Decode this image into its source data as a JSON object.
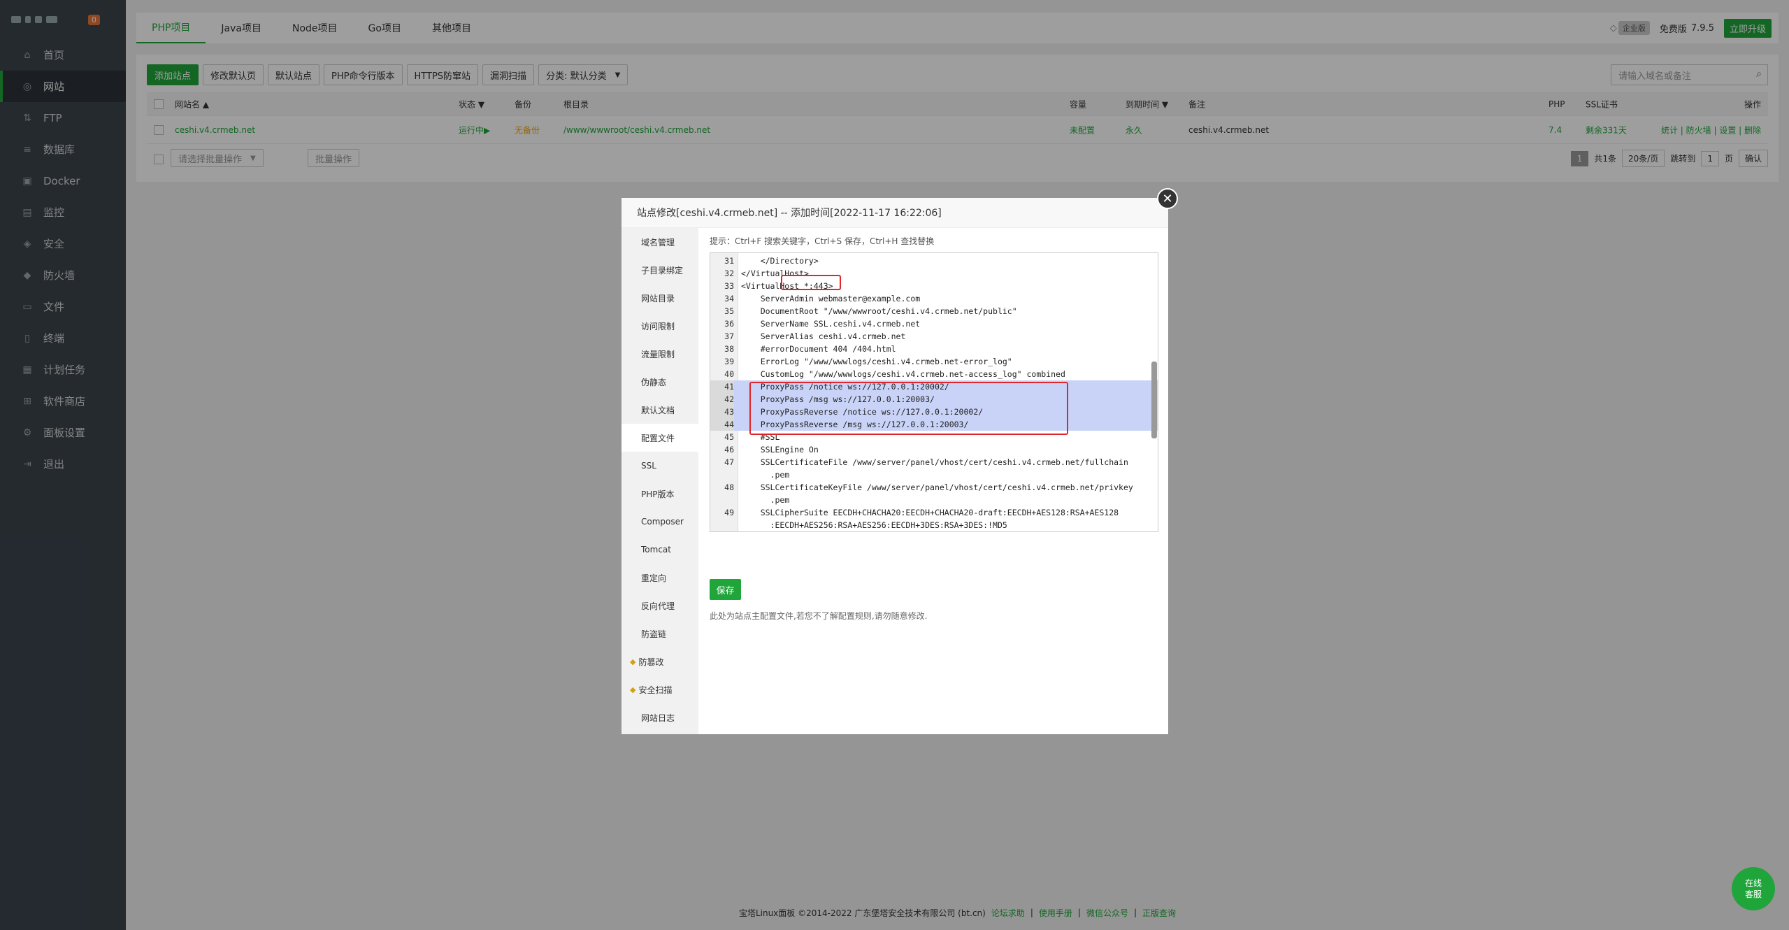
{
  "sidebar": {
    "badge": "0",
    "items": [
      {
        "label": "首页",
        "icon": "home-icon",
        "glyph": "⌂"
      },
      {
        "label": "网站",
        "icon": "globe-icon",
        "glyph": "◎"
      },
      {
        "label": "FTP",
        "icon": "ftp-icon",
        "glyph": "⇅"
      },
      {
        "label": "数据库",
        "icon": "database-icon",
        "glyph": "≡"
      },
      {
        "label": "Docker",
        "icon": "docker-icon",
        "glyph": "▣"
      },
      {
        "label": "监控",
        "icon": "monitor-icon",
        "glyph": "▤"
      },
      {
        "label": "安全",
        "icon": "shield-icon",
        "glyph": "◈"
      },
      {
        "label": "防火墙",
        "icon": "firewall-icon",
        "glyph": "◆"
      },
      {
        "label": "文件",
        "icon": "folder-icon",
        "glyph": "▭"
      },
      {
        "label": "终端",
        "icon": "terminal-icon",
        "glyph": "▯"
      },
      {
        "label": "计划任务",
        "icon": "calendar-icon",
        "glyph": "▦"
      },
      {
        "label": "软件商店",
        "icon": "apps-icon",
        "glyph": "⊞"
      },
      {
        "label": "面板设置",
        "icon": "gear-icon",
        "glyph": "⚙"
      },
      {
        "label": "退出",
        "icon": "logout-icon",
        "glyph": "⇥"
      }
    ]
  },
  "topbar": {
    "tabs": [
      "PHP项目",
      "Java项目",
      "Node项目",
      "Go项目",
      "其他项目"
    ],
    "enterprise": "企业版",
    "edition": "免费版",
    "version": "7.9.5",
    "upgrade": "立即升级"
  },
  "toolbar": {
    "buttons": [
      "添加站点",
      "修改默认页",
      "默认站点",
      "PHP命令行版本",
      "HTTPS防窜站",
      "漏洞扫描"
    ],
    "category": "分类: 默认分类",
    "search_placeholder": "请输入域名或备注"
  },
  "table": {
    "headers": {
      "name": "网站名 ▲",
      "status": "状态 ▼",
      "backup": "备份",
      "root": "根目录",
      "capacity": "容量",
      "expire": "到期时间 ▼",
      "remark": "备注",
      "php": "PHP",
      "ssl": "SSL证书",
      "ops": "操作"
    },
    "row": {
      "name": "ceshi.v4.crmeb.net",
      "status": "运行中▶",
      "backup": "无备份",
      "root": "/www/wwwroot/ceshi.v4.crmeb.net",
      "capacity": "未配置",
      "expire": "永久",
      "remark": "ceshi.v4.crmeb.net",
      "php": "7.4",
      "ssl": "剩余331天",
      "ops": "统计 | 防火墙 | 设置 | 删除"
    },
    "batch_placeholder": "请选择批量操作",
    "batch_button": "批量操作",
    "pager": {
      "page": "1",
      "total": "共1条",
      "per_page": "20条/页",
      "goto": "跳转到",
      "goto_value": "1",
      "page_unit": "页",
      "confirm": "确认"
    }
  },
  "dialog": {
    "title": "站点修改[ceshi.v4.crmeb.net] -- 添加时间[2022-11-17 16:22:06]",
    "side_items": [
      "域名管理",
      "子目录绑定",
      "网站目录",
      "访问限制",
      "流量限制",
      "伪静态",
      "默认文档",
      "配置文件",
      "SSL",
      "PHP版本",
      "Composer",
      "Tomcat",
      "重定向",
      "反向代理",
      "防盗链",
      "防篡改",
      "安全扫描",
      "网站日志"
    ],
    "hint": "提示：Ctrl+F 搜索关键字，Ctrl+S 保存，Ctrl+H 查找替换",
    "save": "保存",
    "note": "此处为站点主配置文件,若您不了解配置规则,请勿随意修改."
  },
  "code_lines": [
    {
      "n": "31",
      "t": "    </Directory>"
    },
    {
      "n": "32",
      "t": "</VirtualHost>"
    },
    {
      "n": "33",
      "t": "<VirtualHost *:443>"
    },
    {
      "n": "34",
      "t": "    ServerAdmin webmaster@example.com"
    },
    {
      "n": "35",
      "t": "    DocumentRoot \"/www/wwwroot/ceshi.v4.crmeb.net/public\""
    },
    {
      "n": "36",
      "t": "    ServerName SSL.ceshi.v4.crmeb.net"
    },
    {
      "n": "37",
      "t": "    ServerAlias ceshi.v4.crmeb.net"
    },
    {
      "n": "38",
      "t": "    #errorDocument 404 /404.html"
    },
    {
      "n": "39",
      "t": "    ErrorLog \"/www/wwwlogs/ceshi.v4.crmeb.net-error_log\""
    },
    {
      "n": "40",
      "t": "    CustomLog \"/www/wwwlogs/ceshi.v4.crmeb.net-access_log\" combined"
    },
    {
      "n": "41",
      "t": "    ProxyPass /notice ws://127.0.0.1:20002/"
    },
    {
      "n": "42",
      "t": "    ProxyPass /msg ws://127.0.0.1:20003/"
    },
    {
      "n": "43",
      "t": "    ProxyPassReverse /notice ws://127.0.0.1:20002/"
    },
    {
      "n": "44",
      "t": "    ProxyPassReverse /msg ws://127.0.0.1:20003/"
    },
    {
      "n": "45",
      "t": "    #SSL"
    },
    {
      "n": "46",
      "t": "    SSLEngine On"
    },
    {
      "n": "47",
      "t": "    SSLCertificateFile /www/server/panel/vhost/cert/ceshi.v4.crmeb.net/fullchain"
    },
    {
      "n": "",
      "t": "      .pem"
    },
    {
      "n": "48",
      "t": "    SSLCertificateKeyFile /www/server/panel/vhost/cert/ceshi.v4.crmeb.net/privkey"
    },
    {
      "n": "",
      "t": "      .pem"
    },
    {
      "n": "49",
      "t": "    SSLCipherSuite EECDH+CHACHA20:EECDH+CHACHA20-draft:EECDH+AES128:RSA+AES128"
    },
    {
      "n": "",
      "t": "      :EECDH+AES256:RSA+AES256:EECDH+3DES:RSA+3DES:!MD5"
    }
  ],
  "footer": {
    "copyright": "宝塔Linux面板 ©2014-2022 广东堡塔安全技术有限公司 (bt.cn)",
    "links": [
      "论坛求助",
      "使用手册",
      "微信公众号",
      "正版查询"
    ]
  },
  "chat": "在线客服"
}
